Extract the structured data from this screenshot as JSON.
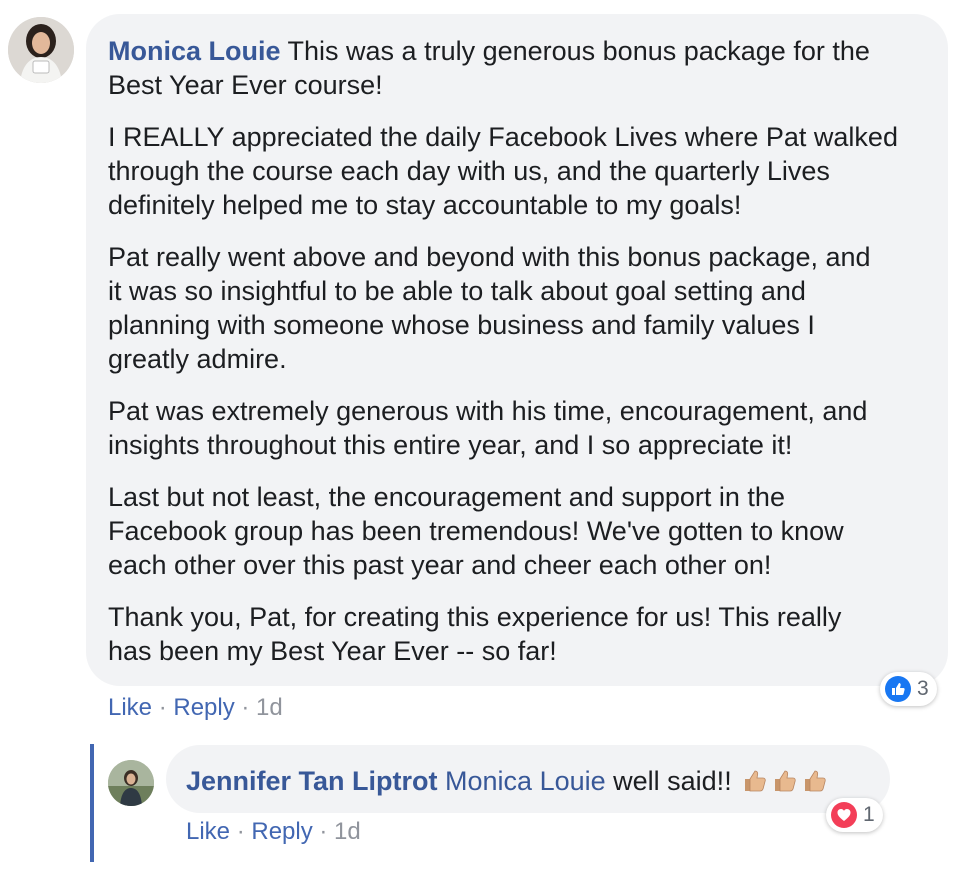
{
  "comment": {
    "author": "Monica Louie",
    "first_line": " This was a truly generous bonus package for the\nBest Year Ever course!",
    "paragraphs": [
      "I REALLY appreciated the daily Facebook Lives where Pat walked\nthrough the course each day with us, and the quarterly Lives\ndefinitely helped me to stay accountable to my goals!",
      "Pat really went above and beyond with this bonus package, and\nit was so insightful to be able to talk about goal setting and\nplanning with someone whose business and family values I\ngreatly admire.",
      "Pat was extremely generous with his time, encouragement, and\ninsights throughout this entire year, and I so appreciate it!",
      "Last but not least, the encouragement and support in the\nFacebook group has been tremendous! We've gotten to know\neach other over this past year and cheer each other on!",
      "Thank you, Pat, for creating this experience for us! This really\nhas been my Best Year Ever -- so far!"
    ],
    "like_label": "Like",
    "reply_label": "Reply",
    "separator": " · ",
    "time": "1d",
    "reaction": {
      "icon": "thumbs-up-icon",
      "count": "3",
      "color": "#1877f2"
    }
  },
  "reply": {
    "author": "Jennifer Tan Liptrot",
    "mention": "Monica Louie",
    "text": " well said!! ",
    "emoji": [
      "thumbs-up-emoji",
      "thumbs-up-emoji",
      "thumbs-up-emoji"
    ],
    "like_label": "Like",
    "reply_label": "Reply",
    "separator": " · ",
    "time": "1d",
    "reaction": {
      "icon": "heart-icon",
      "count": "1",
      "color": "#f33e58"
    }
  },
  "colors": {
    "link": "#385898",
    "action_link": "#4267b2",
    "bubble": "#f2f3f5",
    "thread_line": "#4267b2",
    "meta": "#90949c"
  }
}
